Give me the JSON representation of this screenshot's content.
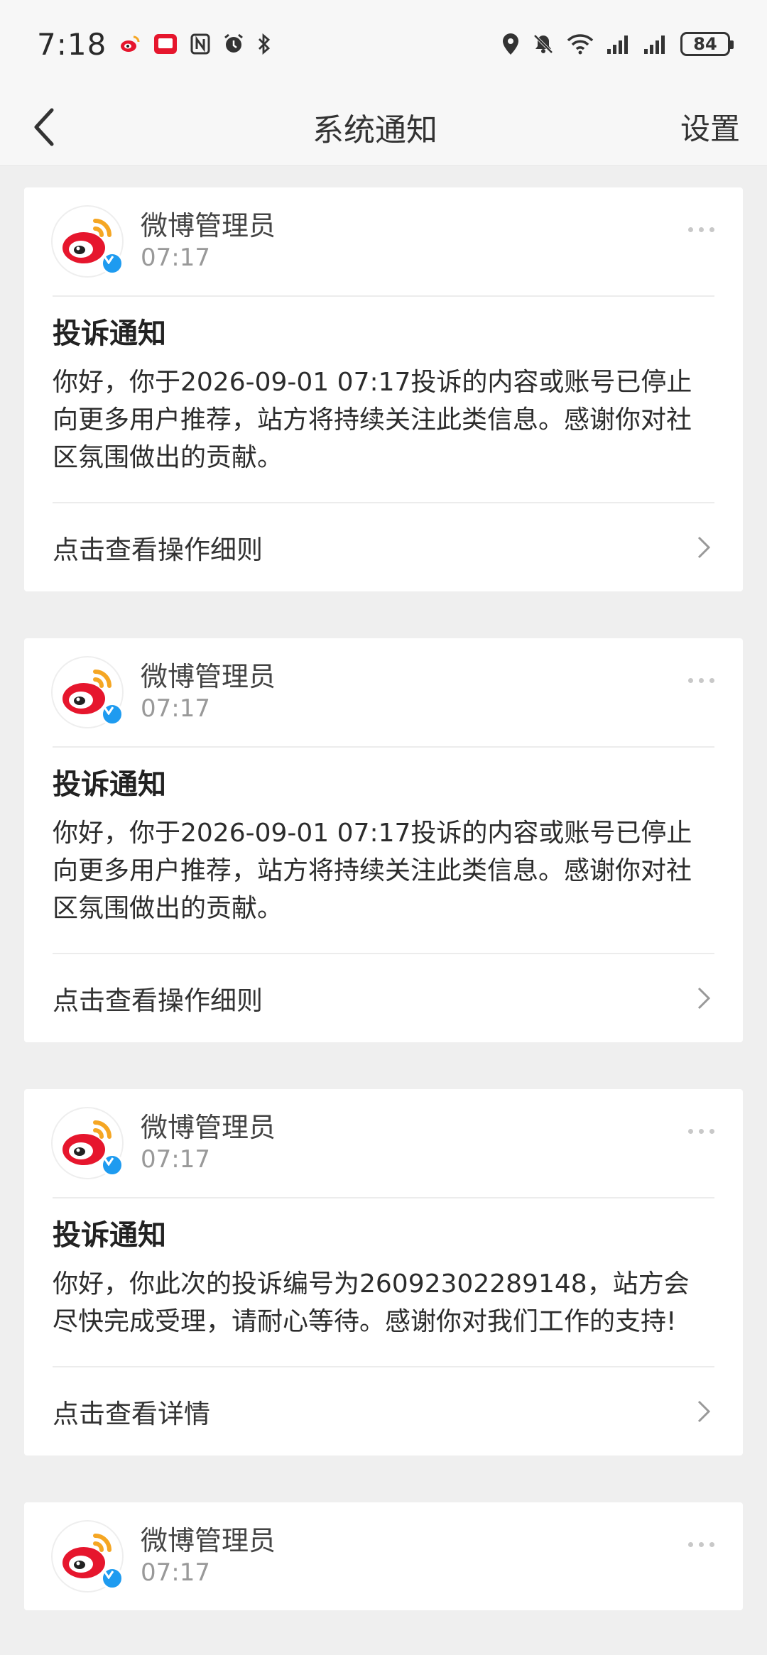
{
  "status_bar": {
    "time": "7:18",
    "left_icons": [
      "weibo-icon",
      "app-icon",
      "nfc-icon",
      "alarm-icon",
      "bluetooth-icon"
    ],
    "right_icons": [
      "location-icon",
      "mute-icon",
      "wifi-icon",
      "signal-icon",
      "signal-icon"
    ],
    "battery": "84"
  },
  "nav": {
    "title": "系统通知",
    "settings": "设置"
  },
  "colors": {
    "background": "#efefef",
    "card": "#ffffff",
    "verified_badge": "#1e9bf0",
    "weibo_red": "#e6162d",
    "weibo_orange": "#f5a623"
  },
  "notifications": [
    {
      "sender": "微博管理员",
      "time": "07:17",
      "title": "投诉通知",
      "text": "你好，你于2026-09-01 07:17投诉的内容或账号已停止向更多用户推荐，站方将持续关注此类信息。感谢你对社区氛围做出的贡献。",
      "link": "点击查看操作细则"
    },
    {
      "sender": "微博管理员",
      "time": "07:17",
      "title": "投诉通知",
      "text": "你好，你于2026-09-01 07:17投诉的内容或账号已停止向更多用户推荐，站方将持续关注此类信息。感谢你对社区氛围做出的贡献。",
      "link": "点击查看操作细则"
    },
    {
      "sender": "微博管理员",
      "time": "07:17",
      "title": "投诉通知",
      "text": "你好，你此次的投诉编号为26092302289148，站方会尽快完成受理，请耐心等待。感谢你对我们工作的支持!",
      "link": "点击查看详情"
    },
    {
      "sender": "微博管理员",
      "time": "07:17"
    }
  ]
}
